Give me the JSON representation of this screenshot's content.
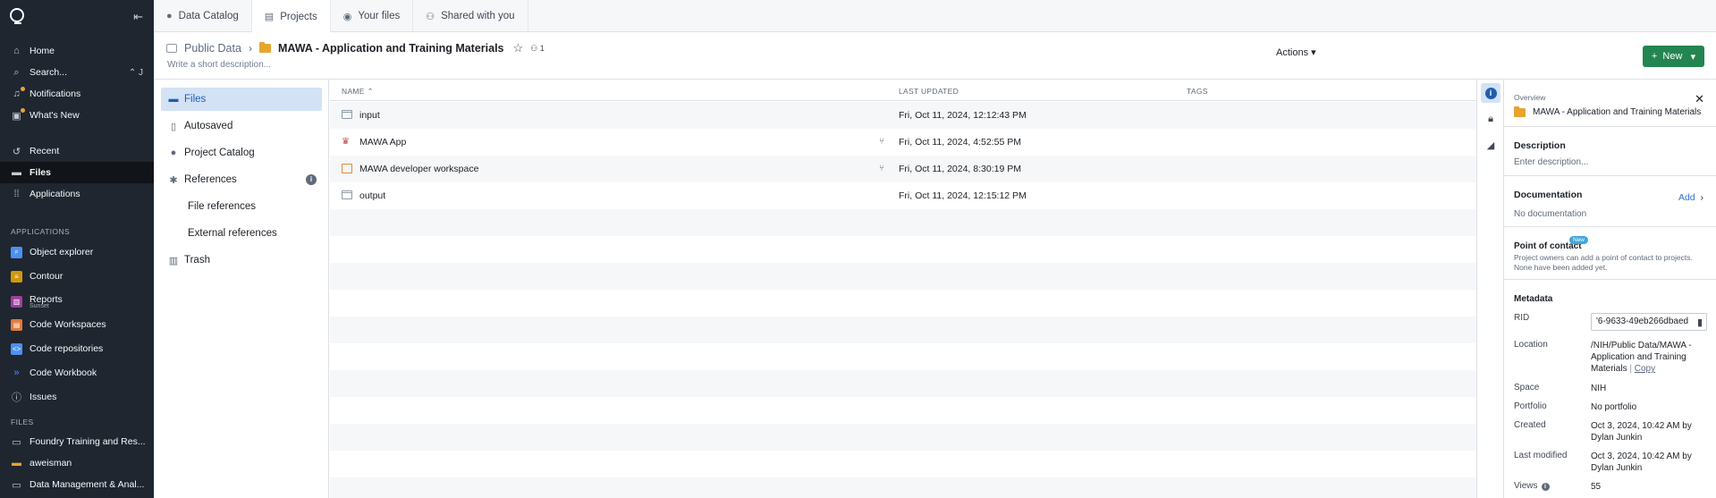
{
  "sidebar": {
    "nav": [
      {
        "label": "Home",
        "icon": "home-icon"
      },
      {
        "label": "Search...",
        "icon": "search-icon",
        "shortcut": "⌃ J"
      },
      {
        "label": "Notifications",
        "icon": "bell-icon"
      },
      {
        "label": "What's New",
        "icon": "gift-icon"
      },
      {
        "label": "Recent",
        "icon": "history-icon"
      },
      {
        "label": "Files",
        "icon": "folder-icon"
      },
      {
        "label": "Applications",
        "icon": "grid-icon"
      }
    ],
    "applications_heading": "APPLICATIONS",
    "applications": [
      {
        "label": "Object explorer",
        "color": "#4c90f0"
      },
      {
        "label": "Contour",
        "color": "#d1980b"
      },
      {
        "label": "Reports",
        "sub": "Sunset",
        "color": "#9d3f9d"
      },
      {
        "label": "Code Workspaces",
        "color": "#e07a3c"
      },
      {
        "label": "Code repositories",
        "color": "#4c90f0"
      },
      {
        "label": "Code Workbook",
        "color": "#2d72d2"
      },
      {
        "label": "Issues",
        "color": "#8f99a8"
      }
    ],
    "files_heading": "FILES",
    "files": [
      {
        "label": "Foundry Training and Res..."
      },
      {
        "label": "aweisman"
      },
      {
        "label": "Data Management & Anal..."
      }
    ]
  },
  "tabs": [
    "Data Catalog",
    "Projects",
    "Your files",
    "Shared with you"
  ],
  "header": {
    "crumb_root": "Public Data",
    "title": "MAWA - Application and Training Materials",
    "people_count": "1",
    "description_placeholder": "Write a short description...",
    "actions_label": "Actions",
    "new_label": "New"
  },
  "filenav": {
    "items": [
      "Files",
      "Autosaved",
      "Project Catalog",
      "References",
      "File references",
      "External references",
      "Trash"
    ]
  },
  "table": {
    "columns": [
      "NAME",
      "LAST UPDATED",
      "TAGS"
    ],
    "rows": [
      {
        "name": "input",
        "updated": "Fri, Oct 11, 2024, 12:12:43 PM"
      },
      {
        "name": "MAWA App",
        "updated": "Fri, Oct 11, 2024, 4:52:55 PM"
      },
      {
        "name": "MAWA developer workspace",
        "updated": "Fri, Oct 11, 2024, 8:30:19 PM"
      },
      {
        "name": "output",
        "updated": "Fri, Oct 11, 2024, 12:15:12 PM"
      }
    ]
  },
  "panel": {
    "overview_label": "Overview",
    "title": "MAWA - Application and Training Materials",
    "description_heading": "Description",
    "description_placeholder": "Enter description...",
    "documentation_heading": "Documentation",
    "documentation_add": "Add",
    "documentation_value": "No documentation",
    "poc_heading": "Point of contact",
    "poc_badge": "New",
    "poc_text": "Project owners can add a point of contact to projects. None have been added yet.",
    "metadata_heading": "Metadata",
    "meta": {
      "rid_label": "RID",
      "rid_value": "'6-9633-49eb266dbaed",
      "location_label": "Location",
      "location_value": "/NIH/Public Data/MAWA - Application and Training Materials",
      "copy_label": "Copy",
      "space_label": "Space",
      "space_value": "NIH",
      "portfolio_label": "Portfolio",
      "portfolio_value": "No portfolio",
      "created_label": "Created",
      "created_value": "Oct 3, 2024, 10:42 AM by Dylan Junkin",
      "modified_label": "Last modified",
      "modified_value": "Oct 3, 2024, 10:42 AM by Dylan Junkin",
      "views_label": "Views",
      "views_value": "55"
    }
  }
}
